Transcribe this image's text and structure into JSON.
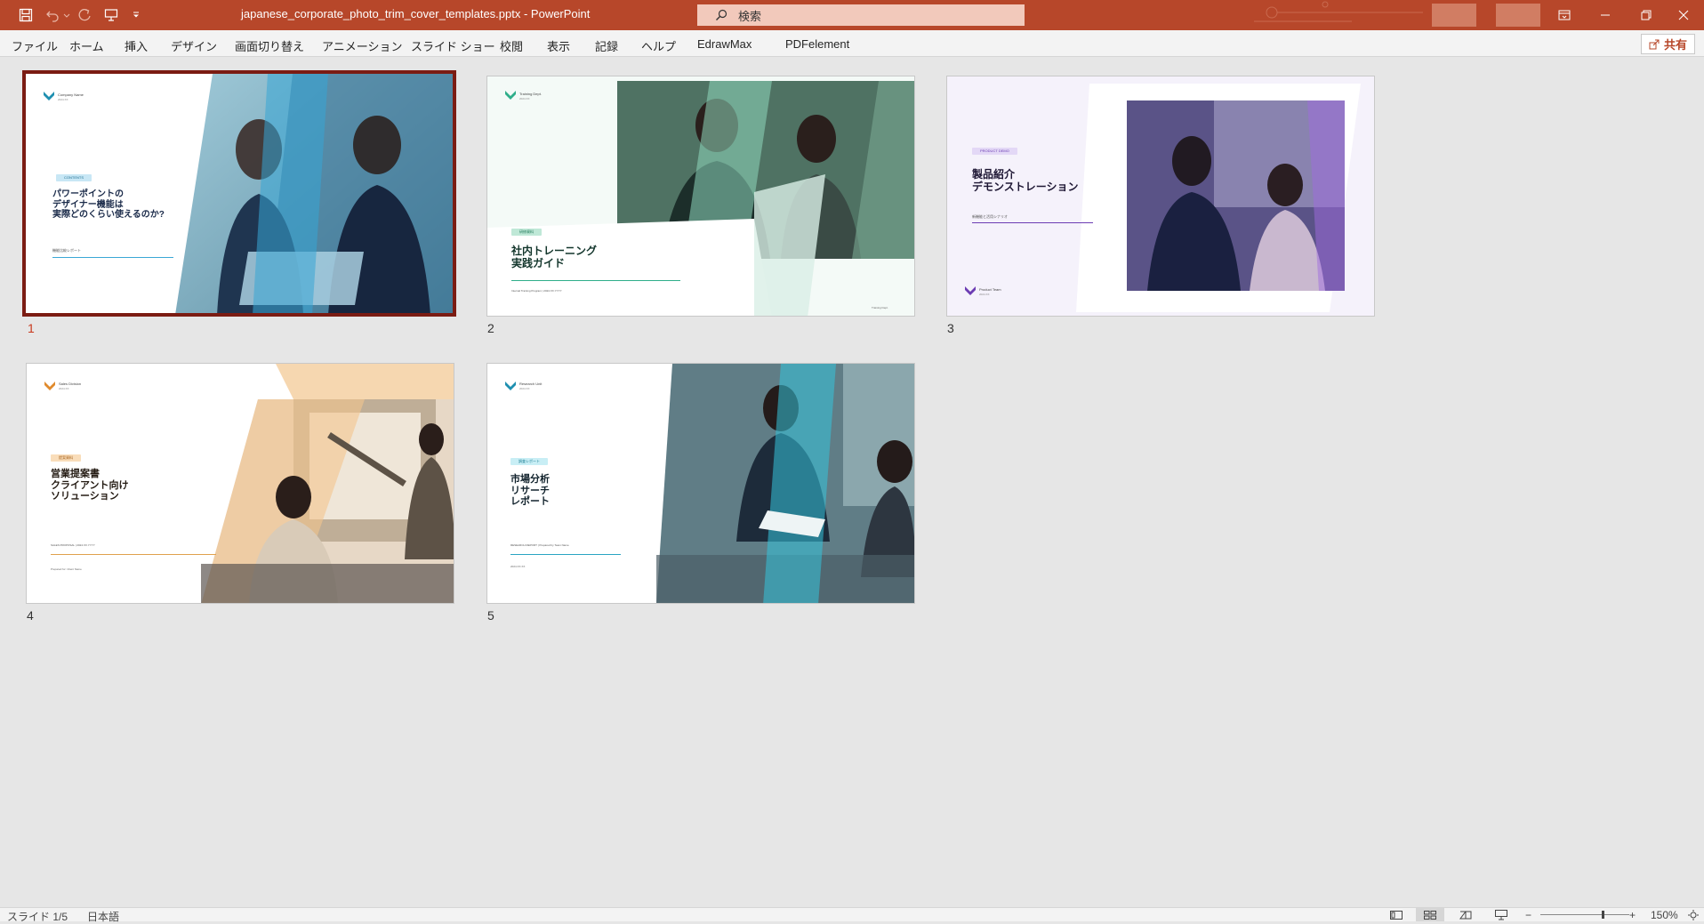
{
  "titlebar": {
    "doc_title": "japanese_corporate_photo_trim_cover_templates.pptx  -  PowerPoint",
    "search_placeholder": "検索"
  },
  "ribbon": {
    "tabs": [
      "ファイル",
      "ホーム",
      "挿入",
      "デザイン",
      "画面切り替え",
      "アニメーション",
      "スライド ショー",
      "校閲",
      "表示",
      "記録",
      "ヘルプ",
      "EdrawMax",
      "PDFelement"
    ],
    "share_label": "共有"
  },
  "slides": [
    {
      "number": "1",
      "company": "Company Name",
      "company_sub": "2024.XX",
      "badge": "CONTENTS",
      "title": "パワーポイントの\nデザイナー機能は\n実際どのくらい使えるのか?",
      "meta": "機能比較レポート",
      "accent": "#3ba7d6",
      "selected": true
    },
    {
      "number": "2",
      "company": "Training Dept.",
      "company_sub": "2024.XX",
      "badge": "研修資料",
      "title": "社内トレーニング\n実践ガイド",
      "meta": "Internal Training Program | 2024.XX.YYYY",
      "footer": "Training Dept.",
      "accent": "#2fae8a",
      "selected": false
    },
    {
      "number": "3",
      "badge": "PRODUCT DEMO",
      "title": "製品紹介\nデモンストレーション",
      "meta": "新機能と活用シナリオ",
      "company": "Product Team",
      "company_sub": "2024.XX",
      "accent": "#6c3cb3",
      "selected": false
    },
    {
      "number": "4",
      "company": "Sales Division",
      "company_sub": "2024.XX",
      "badge": "提案資料",
      "title": "営業提案書\nクライアント向け\nソリューション",
      "meta": "SALES PROPOSAL | 2024.XX.YYYY",
      "footer": "Prepared for: Client Name",
      "accent": "#e08a2c",
      "selected": false
    },
    {
      "number": "5",
      "company": "Research Unit",
      "company_sub": "2024.XX",
      "badge": "調査レポート",
      "title": "市場分析\nリサーチ\nレポート",
      "meta": "RESEARCH REPORT | Prepared by Team Name",
      "footer": "2024.XX.XX",
      "accent": "#2aa5c3",
      "selected": false
    }
  ],
  "status": {
    "slide_indicator": "スライド 1/5",
    "language": "日本語",
    "zoom": "150%"
  },
  "colors": {
    "brand": "#b7472a",
    "selection": "#7b1c13"
  }
}
